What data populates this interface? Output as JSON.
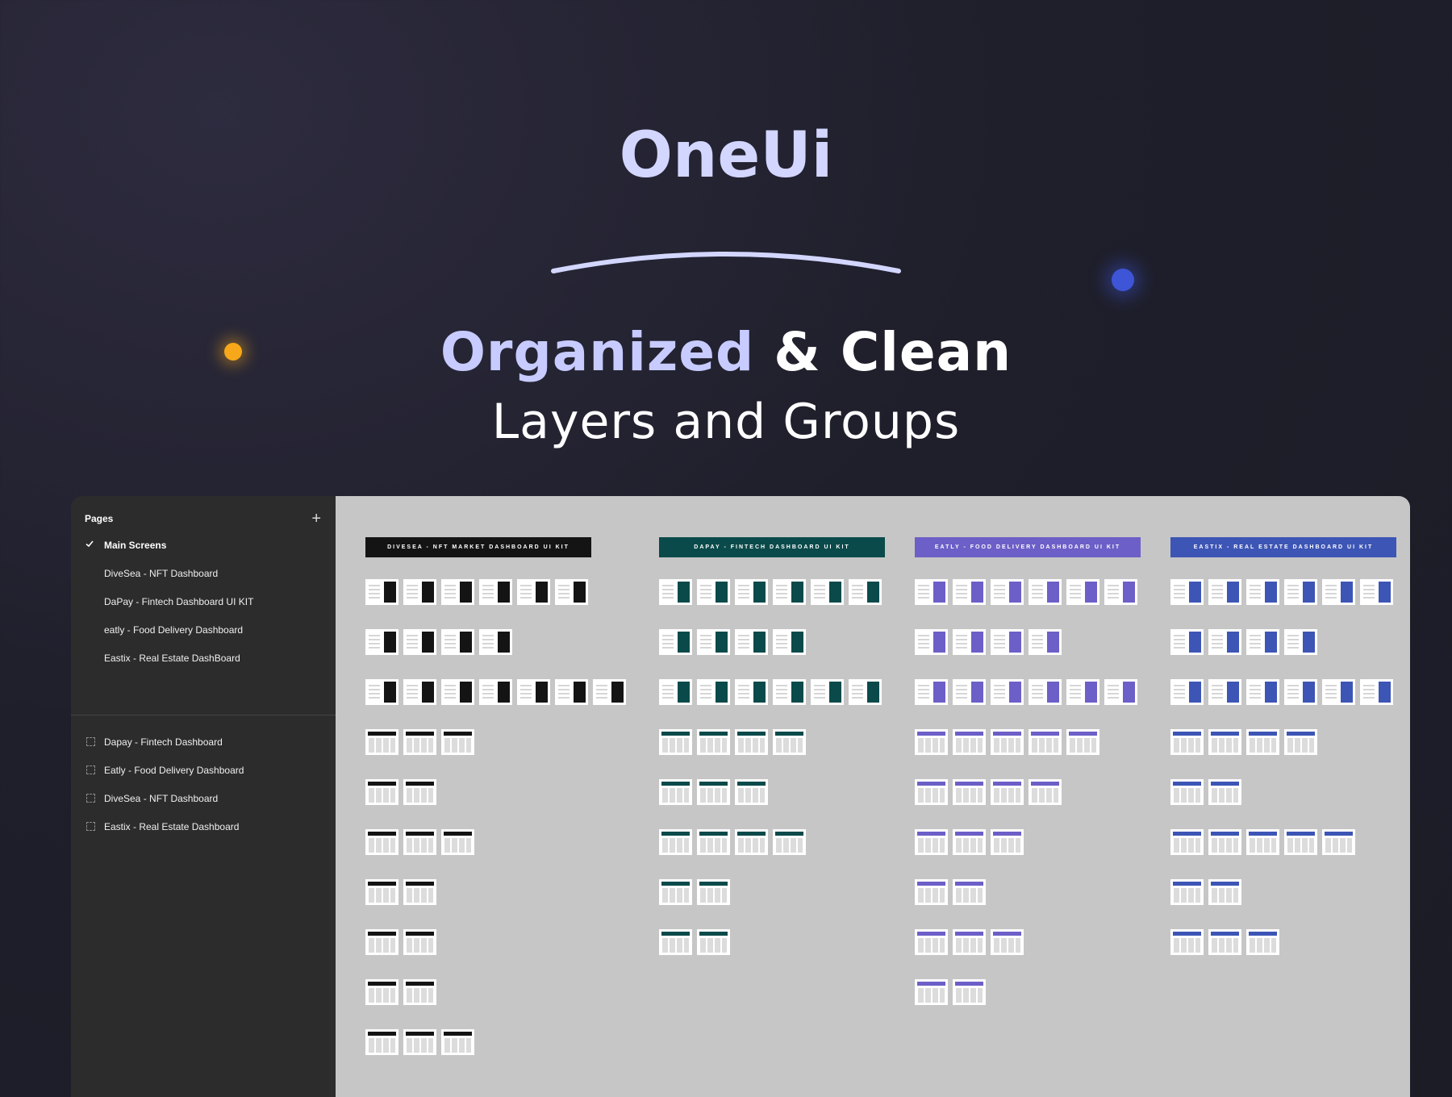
{
  "hero": {
    "title": "OneUi",
    "line1_accent": "Organized",
    "line1_rest": "& Clean",
    "line2": "Layers and Groups"
  },
  "colors": {
    "title": "#d3d6ff",
    "accent": "#c7cbff",
    "orange_dot": "#f6a81a",
    "blue_dot": "#3d55d6",
    "sidebar_bg": "#2c2c2c",
    "canvas_bg": "#c6c6c6"
  },
  "sidebar": {
    "title": "Pages",
    "add_icon": "plus-icon",
    "pages": [
      {
        "label": "Main Screens",
        "active": true,
        "icon": "check-icon"
      },
      {
        "label": "DiveSea - NFT Dashboard"
      },
      {
        "label": "DaPay - Fintech Dashboard UI KIT"
      },
      {
        "label": "eatly - Food Delivery Dashboard"
      },
      {
        "label": "Eastix - Real Estate DashBoard"
      }
    ],
    "layers": [
      {
        "label": "Dapay - Fintech Dashboard",
        "icon": "frame-icon"
      },
      {
        "label": "Eatly - Food Delivery Dashboard",
        "icon": "frame-icon"
      },
      {
        "label": "DiveSea - NFT Dashboard",
        "icon": "frame-icon"
      },
      {
        "label": "Eastix - Real Estate Dashboard",
        "icon": "frame-icon"
      }
    ]
  },
  "canvas": {
    "columns": [
      {
        "banner": "DIVESEA - NFT MARKET DASHBOARD UI KIT",
        "color": "#141414",
        "row_counts": [
          6,
          4,
          7,
          3,
          2,
          3,
          2,
          2,
          2,
          3
        ]
      },
      {
        "banner": "DAPAY - FINTECH DASHBOARD UI KIT",
        "color": "#0b4a4a",
        "row_counts": [
          6,
          4,
          6,
          4,
          3,
          4,
          2,
          2
        ]
      },
      {
        "banner": "EATLY - FOOD DELIVERY DASHBOARD UI KIT",
        "color": "#6c5fc7",
        "row_counts": [
          6,
          4,
          6,
          5,
          4,
          3,
          2,
          3,
          2
        ]
      },
      {
        "banner": "EASTIX - REAL ESTATE DASHBOARD UI KIT",
        "color": "#3d55b5",
        "row_counts": [
          6,
          4,
          6,
          4,
          2,
          5,
          2,
          3
        ]
      }
    ]
  }
}
